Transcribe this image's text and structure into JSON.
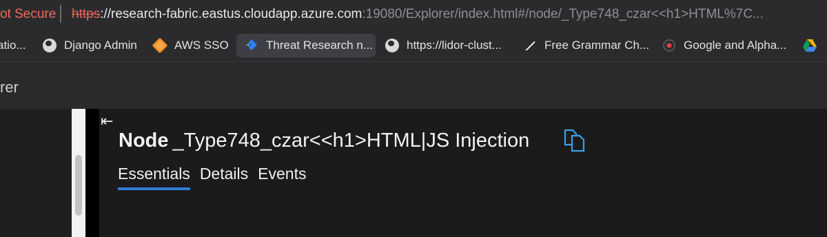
{
  "browser": {
    "security": "ot Secure",
    "url": {
      "protocol": "https",
      "host": "://research-fabric.eastus.cloudapp.azure.com",
      "rest": ":19080/Explorer/index.html#/node/_Type748_czar<<h1>HTML%7C..."
    },
    "bookmarks": [
      {
        "label": "atio...",
        "icon": "none"
      },
      {
        "label": "Django Admin",
        "icon": "globe-icon"
      },
      {
        "label": "AWS SSO",
        "icon": "aws-cube-icon"
      },
      {
        "label": "Threat Research n...",
        "icon": "jira-icon"
      },
      {
        "label": "https://lidor-clust...",
        "icon": "globe-icon"
      },
      {
        "label": "Free Grammar Ch...",
        "icon": "feather-icon"
      },
      {
        "label": "Google and Alpha...",
        "icon": "record-icon"
      },
      {
        "label": "",
        "icon": "google-drive-icon"
      }
    ]
  },
  "app": {
    "title": "rer"
  },
  "node": {
    "kind": "Node",
    "name": "_Type748_czar<<h1>HTML|JS Injection"
  },
  "tabs": [
    "Essentials",
    "Details",
    "Events"
  ],
  "colors": {
    "accent": "#2f7ed8",
    "copy_icon": "#3aa0e6",
    "not_secure": "#f06a5f"
  }
}
